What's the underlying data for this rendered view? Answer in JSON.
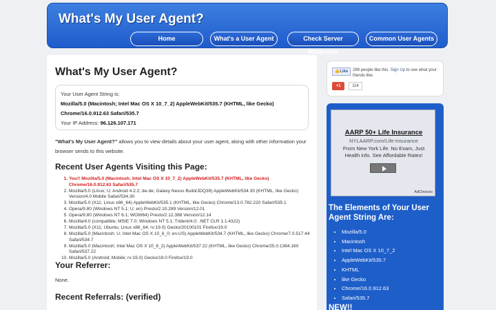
{
  "header": {
    "title": "What's My User Agent?",
    "nav": [
      "Home",
      "What's a User Agent",
      "Check Server Response",
      "Common User Agents"
    ]
  },
  "main": {
    "title": "What's My User Agent?",
    "ua_label": "Your User Agent String is:",
    "ua_string": "Mozilla/5.0 (Macintosh; Intel Mac OS X 10_7_2) AppleWebKit/535.7 (KHTML, like Gecko) Chrome/16.0.912.63 Safari/535.7",
    "ip_label": "Your IP Address:",
    "ip_value": "96.126.107.171",
    "intro_bold": "\"What's My User Agent?\"",
    "intro_rest": " allows you to view details about your user agent, along with other information your browser sends to this website.",
    "recent_heading": "Recent User Agents Visiting this Page:",
    "recent_items": [
      "You!! Mozilla/5.0 (Macintosh; Intel Mac OS X 10_7_2) AppleWebKit/535.7 (KHTML, like Gecko) Chrome/16.0.912.63 Safari/535.7",
      "Mozilla/5.0 (Linux; U; Android 4.2.2; de-de; Galaxy Nexus Build/JDQ39) AppleWebKit/534.30 (KHTML, like Gecko) Version/4.0 Mobile Safari/534.30",
      "Mozilla/5.0 (X11; Linux x86_64) AppleWebKit/535.1 (KHTML, like Gecko) Chrome/13.0.782.220 Safari/535.1",
      "Opera/9.80 (Windows NT 5.1; U; en) Presto/2.10.289 Version/12.01",
      "Opera/9.80 (Windows NT 6.1; WOW64) Presto/2.12.388 Version/12.14",
      "Mozilla/4.0 (compatible; MSIE 7.0; Windows NT 5.1; Trident/4.0; .NET CLR 1.1.4322)",
      "Mozilla/5.0 (X11; Ubuntu; Linux x86_64; rv:19.0) Gecko/20100101 Firefox/19.0",
      "Mozilla/5.0 (Macintosh; U; Intel Mac OS X 10_6_0; en-US) AppleWebKit/534.7 (KHTML, like Gecko) Chrome/7.0.517.44 Safari/534.7",
      "Mozilla/5.0 (Macintosh; Intel Mac OS X 10_8_2) AppleWebKit/537.22 (KHTML, like Gecko) Chrome/25.0.1364.160 Safari/537.22",
      "Mozilla/5.0 (Android; Mobile; rv:19.0) Gecko/19.0 Firefox/19.0"
    ],
    "referrer_heading": "Your Referrer:",
    "referrer_value": "None.",
    "referrals_heading": "Recent Referrals: (verified)"
  },
  "social": {
    "like_label": "Like",
    "like_count_text": "289 people like this.",
    "sign_up": "Sign Up",
    "like_suffix": "to see what your friends like.",
    "gplus_label": "+1",
    "gplus_count": "114"
  },
  "ad": {
    "title": "AARP 50+ Life Insurance",
    "url": "NYLAARP.com/Life-Insurance",
    "desc": "From New York Life. No Exam, Just Health info. See Affordable Rates!",
    "choices": "AdChoices"
  },
  "sidebar": {
    "elements_heading": "The Elements of Your User Agent String Are:",
    "elements": [
      "Mozilla/5.0",
      "Macintosh",
      "Intel Mac OS X 10_7_2",
      "AppleWebKit/535.7",
      "KHTML",
      "like Gecko",
      "Chrome/16.0.912.63",
      "Safari/535.7"
    ],
    "new_heading": "NEW!!"
  },
  "colors": {
    "header_blue": "#2a6bd8",
    "sidebar_blue": "#1e5ec9",
    "highlight_red": "#d11a1a"
  }
}
